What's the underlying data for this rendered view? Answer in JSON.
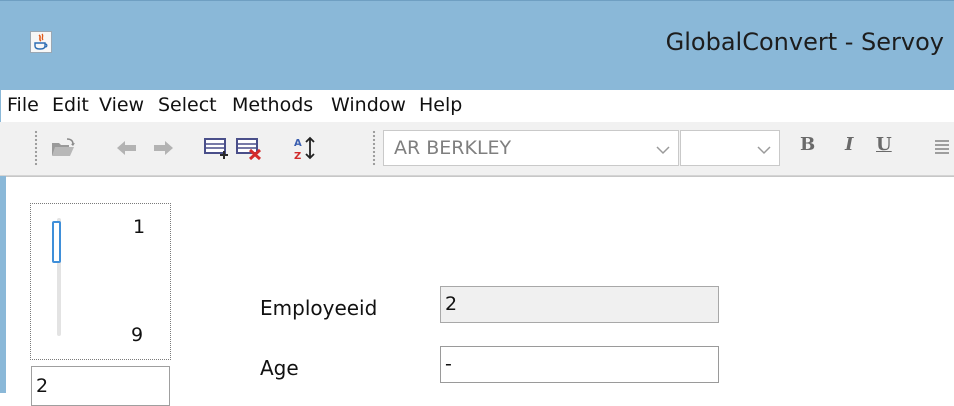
{
  "window": {
    "title": "GlobalConvert - Servoy"
  },
  "menu": {
    "items": [
      "File",
      "Edit",
      "View",
      "Select",
      "Methods",
      "Window",
      "Help"
    ]
  },
  "toolbar": {
    "icons": [
      "open-folder-icon",
      "back-arrow-icon",
      "forward-arrow-icon",
      "new-record-icon",
      "delete-record-icon",
      "sort-icon"
    ],
    "font_combo_value": "AR BERKLEY",
    "size_combo_value": "",
    "bold_label": "B",
    "italic_label": "I",
    "underline_label": "U"
  },
  "record_slider": {
    "top_label": "1",
    "bottom_label": "9",
    "current_record": "2"
  },
  "form": {
    "fields": [
      {
        "label": "Employeeid",
        "value": "2",
        "readonly": true
      },
      {
        "label": "Age",
        "value": "-",
        "readonly": false
      }
    ]
  },
  "colors": {
    "titlebar": "#8ab8d8",
    "slider_thumb": "#3f8fd9",
    "readonly_field": "#f0f0f0"
  }
}
